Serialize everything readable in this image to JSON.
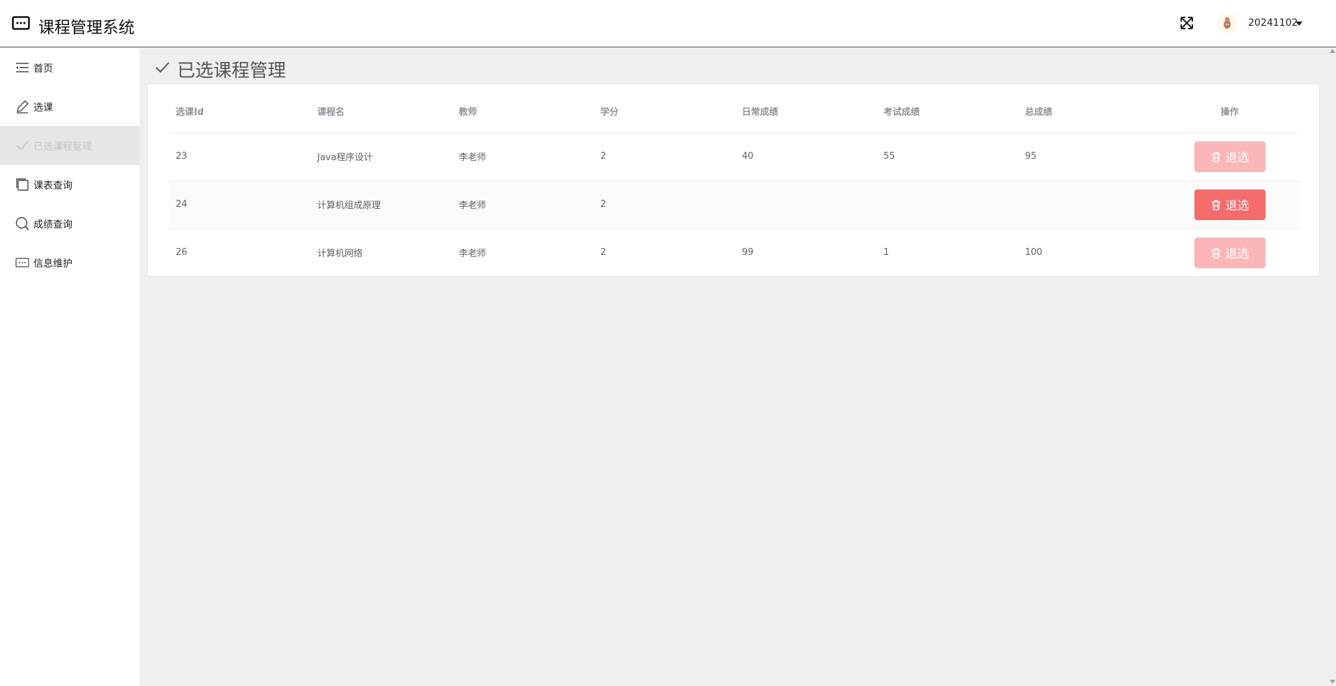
{
  "header": {
    "app_title": "课程管理系统",
    "user_name": "20241102",
    "icons": {
      "logo": "message-dots-icon",
      "fullscreen": "fullscreen-icon",
      "caret": "caret-down-icon"
    }
  },
  "sidebar": {
    "items": [
      {
        "label": "首页",
        "icon": "menu-icon"
      },
      {
        "label": "选课",
        "icon": "edit-icon"
      },
      {
        "label": "已选课程管理",
        "icon": "check-icon",
        "active": true
      },
      {
        "label": "课表查询",
        "icon": "copy-document-icon"
      },
      {
        "label": "成绩查询",
        "icon": "search-icon"
      },
      {
        "label": "信息维护",
        "icon": "more-icon"
      }
    ]
  },
  "main": {
    "page_title": "已选课程管理",
    "table": {
      "columns": [
        "选课Id",
        "课程名",
        "教师",
        "学分",
        "日常成绩",
        "考试成绩",
        "总成绩",
        "操作"
      ],
      "rows": [
        {
          "id": "23",
          "course": "Java程序设计",
          "teacher": "李老师",
          "credit": "2",
          "daily": "40",
          "exam": "55",
          "total": "95",
          "action": "退选",
          "disabled": true
        },
        {
          "id": "24",
          "course": "计算机组成原理",
          "teacher": "李老师",
          "credit": "2",
          "daily": "",
          "exam": "",
          "total": "",
          "action": "退选",
          "disabled": false
        },
        {
          "id": "26",
          "course": "计算机网络",
          "teacher": "李老师",
          "credit": "2",
          "daily": "99",
          "exam": "1",
          "total": "100",
          "action": "退选",
          "disabled": true
        }
      ]
    }
  },
  "colors": {
    "danger": "#f56c6c",
    "danger_disabled": "#fab6b6",
    "background": "#efefef",
    "active_menu": "#e6e6e6"
  }
}
